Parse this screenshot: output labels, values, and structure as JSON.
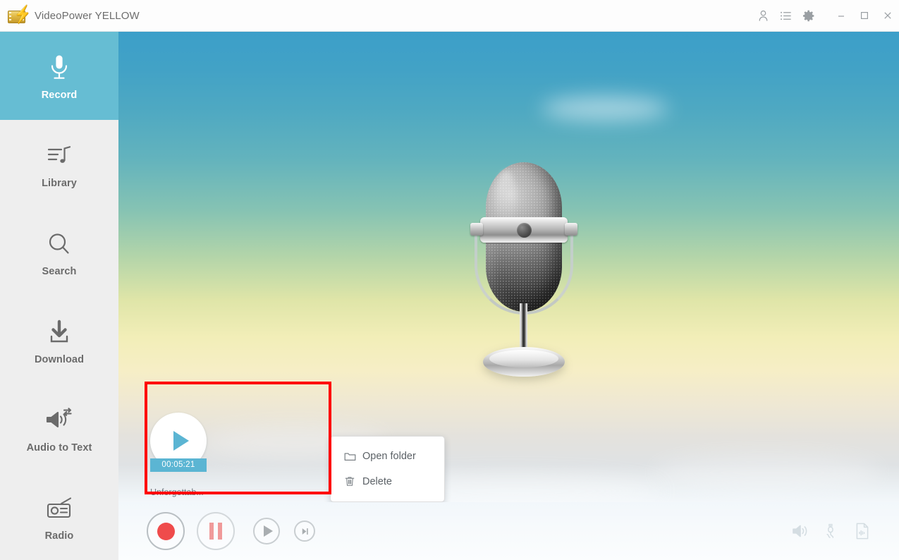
{
  "window": {
    "title": "VideoPower YELLOW",
    "app_icon": "videopower-bolt-icon"
  },
  "titlebar": {
    "icons": [
      {
        "name": "account-icon",
        "label": "Account"
      },
      {
        "name": "task-list-icon",
        "label": "Task list"
      },
      {
        "name": "settings-gear-icon",
        "label": "Settings"
      }
    ],
    "window_controls": [
      {
        "name": "minimize-button",
        "label": "Minimize"
      },
      {
        "name": "maximize-button",
        "label": "Maximize"
      },
      {
        "name": "close-button",
        "label": "Close"
      }
    ]
  },
  "sidebar": {
    "active_index": 0,
    "active_color": "#66bdd3",
    "items": [
      {
        "label": "Record",
        "icon": "microphone-icon"
      },
      {
        "label": "Library",
        "icon": "music-list-icon"
      },
      {
        "label": "Search",
        "icon": "search-icon"
      },
      {
        "label": "Download",
        "icon": "download-icon"
      },
      {
        "label": "Audio to Text",
        "icon": "audio-to-text-icon"
      },
      {
        "label": "Radio",
        "icon": "radio-icon"
      }
    ]
  },
  "stage": {
    "artwork": "vintage-microphone-illustration",
    "background_top_color": "#3c9fc9",
    "background_mid_color": "#f2eeb8",
    "background_bottom_color": "#f3f7fa"
  },
  "recording": {
    "duration": "00:05:21",
    "name": "Unforgettab...",
    "play_icon": "play-icon",
    "accent_color": "#5bb5d3"
  },
  "context_menu": {
    "items": [
      {
        "label": "Open folder",
        "icon": "folder-icon"
      },
      {
        "label": "Delete",
        "icon": "trash-icon"
      }
    ]
  },
  "highlight": {
    "color": "#ff0000"
  },
  "transport": {
    "buttons": [
      {
        "name": "record-button",
        "label": "Record",
        "icon": "record-dot-icon"
      },
      {
        "name": "pause-button",
        "label": "Pause",
        "icon": "pause-icon"
      },
      {
        "name": "play-button",
        "label": "Play",
        "icon": "play-icon"
      },
      {
        "name": "next-button",
        "label": "Next",
        "icon": "skip-next-icon"
      }
    ],
    "utility_icons": [
      {
        "name": "speaker-icon",
        "label": "System sound"
      },
      {
        "name": "microphone-plug-icon",
        "label": "Microphone input"
      },
      {
        "name": "audio-file-icon",
        "label": "Output file"
      }
    ]
  }
}
